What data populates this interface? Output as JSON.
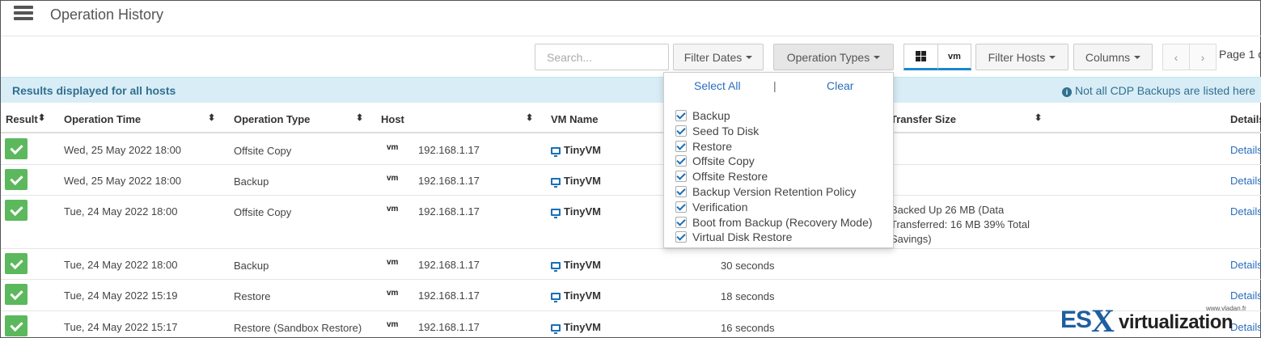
{
  "app": {
    "title": "Operation History",
    "menu_icon": "server-list-icon"
  },
  "toolbar": {
    "search_placeholder": "Search...",
    "filter_dates": "Filter Dates",
    "operation_types": "Operation Types",
    "hyperv_icon": "windows-icon",
    "vmware_label": "vm",
    "filter_hosts": "Filter Hosts",
    "columns": "Columns",
    "prev": "‹",
    "next": "›",
    "page_info": "Page 1 o"
  },
  "banner": {
    "left": "Results displayed for all hosts",
    "right": "Not all CDP Backups are listed here",
    "info_icon": "i"
  },
  "table": {
    "headers": {
      "result": "Result",
      "op_time": "Operation Time",
      "op_type": "Operation Type",
      "host": "Host",
      "vm_name": "VM Name",
      "transfer": "Transfer Size",
      "details": "Details"
    },
    "sort_icon": "⬍",
    "rows": [
      {
        "time": "Wed, 25 May 2022 18:00",
        "type": "Offsite Copy",
        "host_type": "vm",
        "host": "192.168.1.17",
        "vm": "TinyVM",
        "duration": "",
        "transfer": "",
        "details": "Details"
      },
      {
        "time": "Wed, 25 May 2022 18:00",
        "type": "Backup",
        "host_type": "vm",
        "host": "192.168.1.17",
        "vm": "TinyVM",
        "duration": "",
        "transfer": "",
        "details": "Details"
      },
      {
        "time": "Tue, 24 May 2022 18:00",
        "type": "Offsite Copy",
        "host_type": "vm",
        "host": "192.168.1.17",
        "vm": "TinyVM",
        "duration": "",
        "transfer": "Backed Up 26 MB (Data Transferred: 16 MB 39% Total Savings)",
        "details": "Details"
      },
      {
        "time": "Tue, 24 May 2022 18:00",
        "type": "Backup",
        "host_type": "vm",
        "host": "192.168.1.17",
        "vm": "TinyVM",
        "duration": "30 seconds",
        "transfer": "",
        "details": "Details"
      },
      {
        "time": "Tue, 24 May 2022 15:19",
        "type": "Restore",
        "host_type": "vm",
        "host": "192.168.1.17",
        "vm": "TinyVM",
        "duration": "18 seconds",
        "transfer": "",
        "details": "Details"
      },
      {
        "time": "Tue, 24 May 2022 15:17",
        "type": "Restore (Sandbox Restore)",
        "host_type": "vm",
        "host": "192.168.1.17",
        "vm": "TinyVM",
        "duration": "16 seconds",
        "transfer": "",
        "details": "Details"
      }
    ]
  },
  "dropdown": {
    "select_all": "Select All",
    "separator": "|",
    "clear": "Clear",
    "options": [
      {
        "label": "Backup",
        "checked": true
      },
      {
        "label": "Seed To Disk",
        "checked": true
      },
      {
        "label": "Restore",
        "checked": true
      },
      {
        "label": "Offsite Copy",
        "checked": true
      },
      {
        "label": "Offsite Restore",
        "checked": true
      },
      {
        "label": "Backup Version Retention Policy",
        "checked": true
      },
      {
        "label": "Verification",
        "checked": true
      },
      {
        "label": "Boot from Backup (Recovery Mode)",
        "checked": true
      },
      {
        "label": "Virtual Disk Restore",
        "checked": true
      }
    ]
  },
  "watermark": {
    "es": "ES",
    "x": "X",
    "virt": "virtualization",
    "site": "www.vladan.fr"
  },
  "colors": {
    "accent": "#1a88c9",
    "success": "#5cb85c",
    "banner_bg": "#d9edf7",
    "banner_text": "#31708f",
    "link": "#2a6ebb"
  }
}
